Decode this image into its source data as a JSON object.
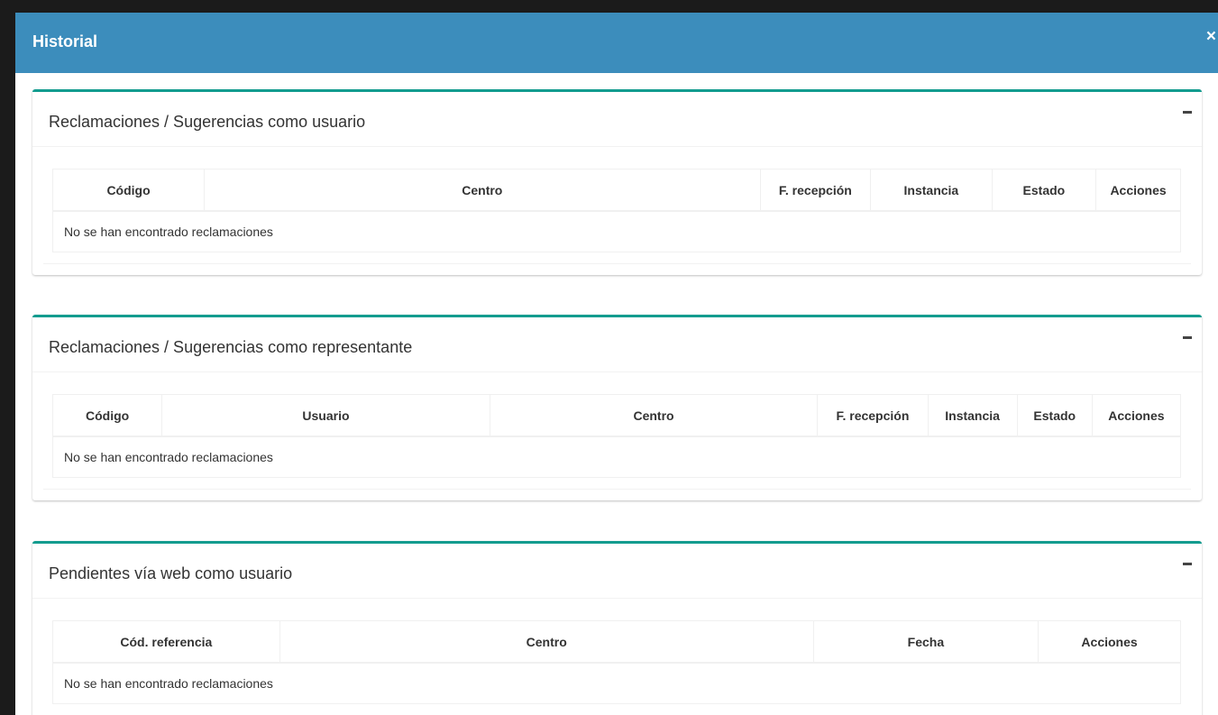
{
  "modal": {
    "title": "Historial",
    "close_label": "×"
  },
  "sections": [
    {
      "title": "Reclamaciones / Sugerencias como usuario",
      "columns": [
        "Código",
        "Centro",
        "F. recepción",
        "Instancia",
        "Estado",
        "Acciones"
      ],
      "empty_message": "No se han encontrado reclamaciones"
    },
    {
      "title": "Reclamaciones / Sugerencias como representante",
      "columns": [
        "Código",
        "Usuario",
        "Centro",
        "F. recepción",
        "Instancia",
        "Estado",
        "Acciones"
      ],
      "empty_message": "No se han encontrado reclamaciones"
    },
    {
      "title": "Pendientes vía web como usuario",
      "columns": [
        "Cód. referencia",
        "Centro",
        "Fecha",
        "Acciones"
      ],
      "empty_message": "No se han encontrado reclamaciones"
    }
  ],
  "colors": {
    "header": "#3c8dbc",
    "box_border": "#139c8f",
    "backdrop": "#1b1b1b"
  },
  "icons": {
    "close": "close-icon",
    "collapse": "minus-icon"
  }
}
